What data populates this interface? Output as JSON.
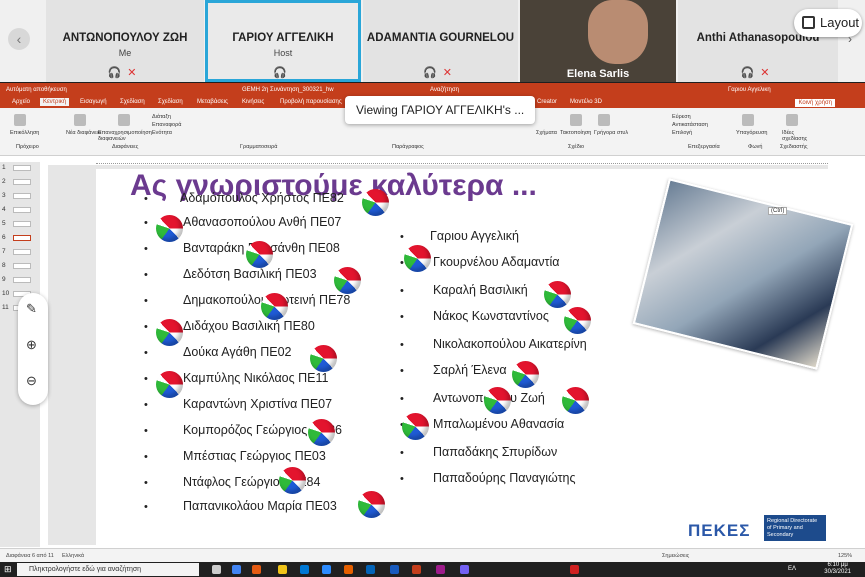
{
  "participants": [
    {
      "name": "ΑΝΤΩΝΟΠΟΥΛΟΥ ΖΩΗ",
      "role": "Me"
    },
    {
      "name": "ΓΑΡΙΟΥ ΑΓΓΕΛΙΚΗ",
      "role": "Host"
    },
    {
      "name": "ADAMANTIA GOURNELOU",
      "role": ""
    },
    {
      "name": "Elena Sarlis",
      "role": ""
    },
    {
      "name": "Anthi Athanasopoulou",
      "role": ""
    }
  ],
  "layout_label": "Layout",
  "viewing_label": "Viewing ΓΑΡΙΟΥ ΑΓΓΕΛΙΚΗ's ...",
  "ppt": {
    "autosave": "Αυτόματη αποθήκευση",
    "filename": "GEMH 2η Συνάντηση_300321_hw",
    "search": "Αναζήτηση",
    "user": "Γαριου Αγγελικη",
    "tabs": [
      "Αρχείο",
      "Κεντρική",
      "Εισαγωγή",
      "Σχεδίαση",
      "Σχεδίαση",
      "Μεταβάσεις",
      "Κινήσεις",
      "Προβολή παρουσίασης",
      "Creator",
      "Μοντέλο 3D"
    ],
    "active_tab": "Κεντρική",
    "share": "Κοινή χρήση",
    "ribbon_groups": [
      "Πρόχειρο",
      "Διαφάνειες",
      "Γραμματοσειρά",
      "Παράγραφος",
      "Σχέδιο",
      "Επεξεργασία",
      "Φωνή",
      "Σχεδιαστής"
    ],
    "ribbon_buttons": [
      "Επικόλληση",
      "Νέα διαφάνεια",
      "Επαναχρησιμοποίηση διαφανειών",
      "Διάταξη",
      "Επαναφορά",
      "Ενότητα",
      "Σχήματα",
      "Τακτοποίηση",
      "Γρήγορα στυλ",
      "Εύρεση",
      "Αντικατάσταση",
      "Επιλογή",
      "Υπαγόρευση",
      "Ιδέες σχεδίασης"
    ],
    "status": {
      "slide": "Διαφάνεια 6 από 11",
      "lang": "Ελληνικά",
      "notes": "Σημειώσεις",
      "zoom": "125%"
    }
  },
  "slide": {
    "title": "Ας γνωριστούμε καλύτερα ...",
    "left_list": [
      "Αδαμόπουλος Χρήστος ΠΕ82",
      "Αθανασοπούλου Ανθή ΠΕ07",
      "Βανταράκη Ρουσάνθη ΠΕ08",
      "Δεδότση Βασιλική ΠΕ03",
      "Δημακοπούλου Ρωτεινή ΠΕ78",
      "Διδάχου Βασιλική ΠΕ80",
      "Δούκα Αγάθη ΠΕ02",
      "Καμπύλης Νικόλαος ΠΕ11",
      "Καραντώνη Χριστίνα ΠΕ07",
      "Κομπορόζος Γεώργιος ΠΕ86",
      "Μπέστιας Γεώργιος ΠΕ03",
      "Ντάφλος Γεώργιος ΠΕ84",
      "Παπανικολάου Μαρία ΠΕ03"
    ],
    "right_list": [
      "Γαριου Αγγελική",
      "Γκουρνέλου Αδαμαντία",
      "Καραλή Βασιλική",
      "Νάκος Κωνσταντίνος",
      "Νικολακοπούλου Αικατερίνη",
      "Σαρλή Έλενα",
      "Αντωνοπούλου Ζωή",
      "Μπαλωμένου Αθανασία",
      "Παπαδάκης Σπυρίδων",
      "Παπαδούρης Παναγιώτης"
    ],
    "ctrl_tag": "(Ctrl)",
    "logo_text": "ΠΕΚΕΣ",
    "regional_text": "Regional Directorate of Primary and Secondary"
  },
  "thumb_numbers": [
    "1",
    "2",
    "3",
    "4",
    "5",
    "6",
    "7",
    "8",
    "9",
    "10",
    "11"
  ],
  "taskbar": {
    "search_placeholder": "Πληκτρολογήστε εδώ για αναζήτηση",
    "time": "6:10 μμ",
    "date": "30/3/2021",
    "lang": "ΕΛ"
  },
  "colors": {
    "accent": "#c43e1c",
    "title": "#6b3a8f",
    "host_border": "#2aa6d8"
  }
}
